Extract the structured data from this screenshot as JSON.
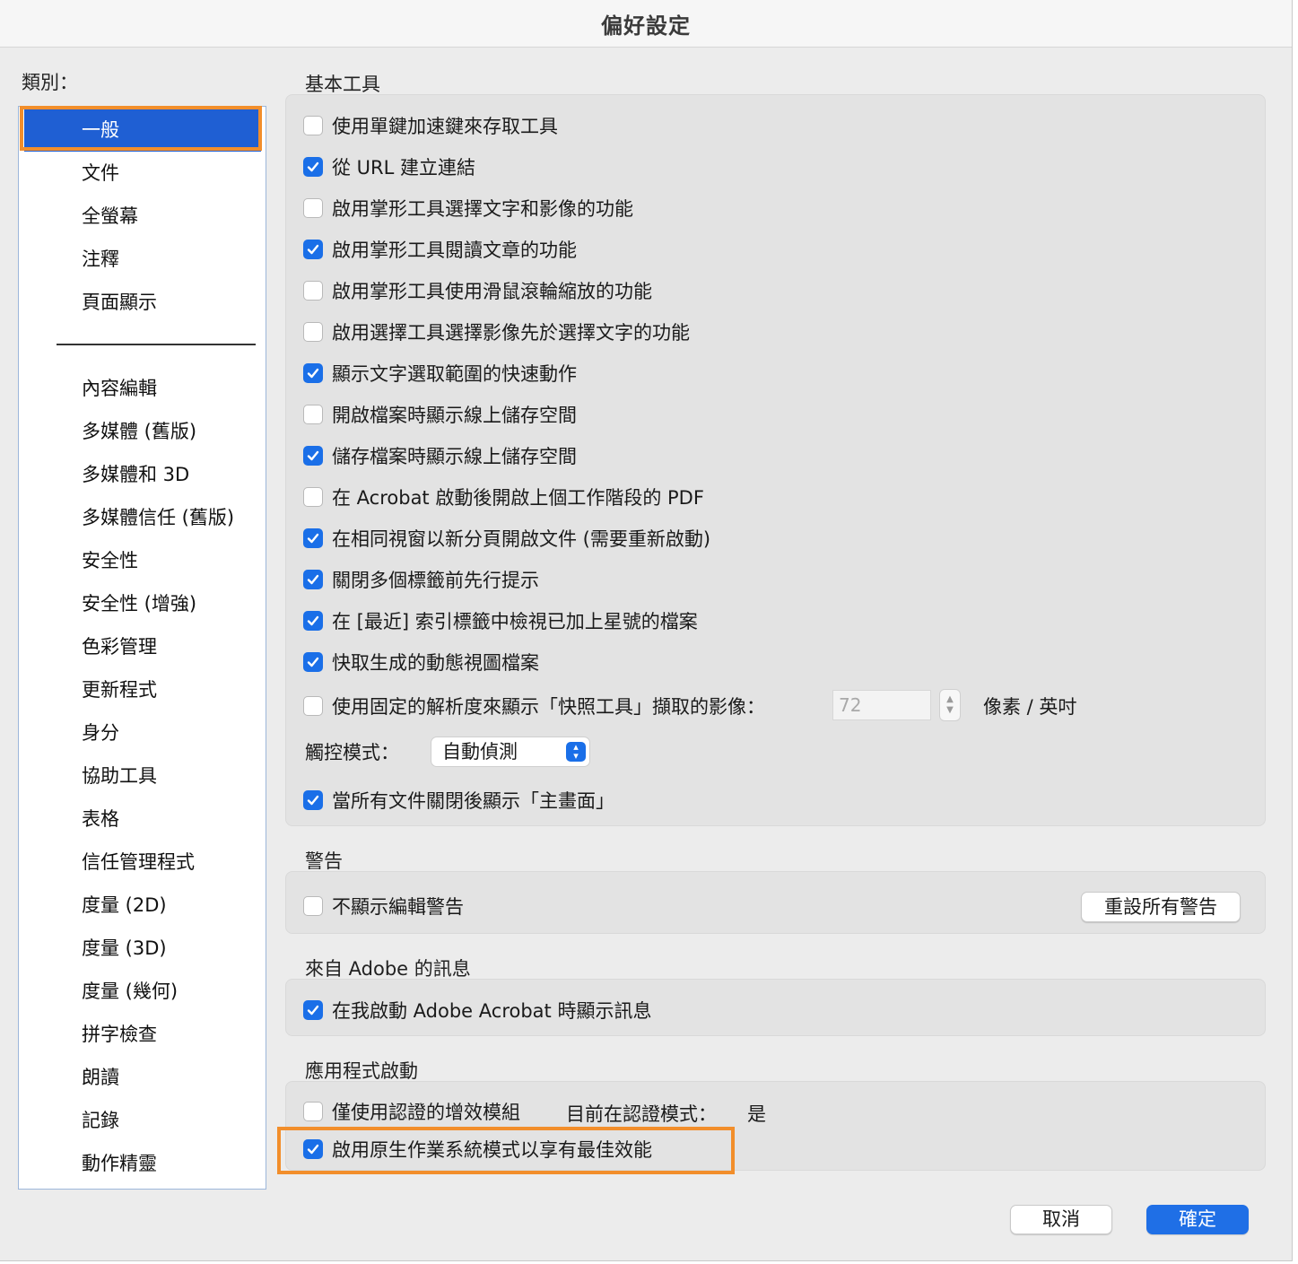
{
  "window": {
    "title": "偏好設定"
  },
  "sidebar": {
    "label": "類別：",
    "items": [
      {
        "label": "一般"
      },
      {
        "label": "文件"
      },
      {
        "label": "全螢幕"
      },
      {
        "label": "注釋"
      },
      {
        "label": "頁面顯示"
      },
      {
        "label": "內容編輯"
      },
      {
        "label": "多媒體 (舊版)"
      },
      {
        "label": "多媒體和 3D"
      },
      {
        "label": "多媒體信任 (舊版)"
      },
      {
        "label": "安全性"
      },
      {
        "label": "安全性 (增強)"
      },
      {
        "label": "色彩管理"
      },
      {
        "label": "更新程式"
      },
      {
        "label": "身分"
      },
      {
        "label": "協助工具"
      },
      {
        "label": "表格"
      },
      {
        "label": "信任管理程式"
      },
      {
        "label": "度量 (2D)"
      },
      {
        "label": "度量 (3D)"
      },
      {
        "label": "度量 (幾何)"
      },
      {
        "label": "拼字檢查"
      },
      {
        "label": "朗讀"
      },
      {
        "label": "記錄"
      },
      {
        "label": "動作精靈"
      }
    ],
    "selected": "一般"
  },
  "basic_tools": {
    "title": "基本工具",
    "options": [
      {
        "label": "使用單鍵加速鍵來存取工具",
        "checked": false
      },
      {
        "label": "從 URL 建立連結",
        "checked": true
      },
      {
        "label": "啟用掌形工具選擇文字和影像的功能",
        "checked": false
      },
      {
        "label": "啟用掌形工具閱讀文章的功能",
        "checked": true
      },
      {
        "label": "啟用掌形工具使用滑鼠滾輪縮放的功能",
        "checked": false
      },
      {
        "label": "啟用選擇工具選擇影像先於選擇文字的功能",
        "checked": false
      },
      {
        "label": "顯示文字選取範圍的快速動作",
        "checked": true
      },
      {
        "label": "開啟檔案時顯示線上儲存空間",
        "checked": false
      },
      {
        "label": "儲存檔案時顯示線上儲存空間",
        "checked": true
      },
      {
        "label": "在 Acrobat 啟動後開啟上個工作階段的 PDF",
        "checked": false
      },
      {
        "label": "在相同視窗以新分頁開啟文件 (需要重新啟動)",
        "checked": true
      },
      {
        "label": "關閉多個標籤前先行提示",
        "checked": true
      },
      {
        "label": "在 [最近] 索引標籤中檢視已加上星號的檔案",
        "checked": true
      },
      {
        "label": "快取生成的動態視圖檔案",
        "checked": true
      },
      {
        "label": "使用固定的解析度來顯示「快照工具」擷取的影像：",
        "checked": false
      }
    ],
    "resolution_value": "72",
    "resolution_unit": "像素 / 英吋",
    "touch_mode_label": "觸控模式：",
    "touch_mode_value": "自動偵測",
    "home_option": {
      "label": "當所有文件關閉後顯示「主畫面」",
      "checked": true
    }
  },
  "warnings": {
    "title": "警告",
    "option": {
      "label": "不顯示編輯警告",
      "checked": false
    },
    "reset_button": "重設所有警告"
  },
  "adobe_messages": {
    "title": "來自 Adobe 的訊息",
    "option": {
      "label": "在我啟動 Adobe Acrobat 時顯示訊息",
      "checked": true
    }
  },
  "app_startup": {
    "title": "應用程式啟動",
    "certified_option": {
      "label": "僅使用認證的增效模組",
      "checked": false
    },
    "cert_mode_label": "目前在認證模式：",
    "cert_mode_value": "是",
    "native_option": {
      "label": "啟用原生作業系統模式以享有最佳效能",
      "checked": true
    }
  },
  "footer": {
    "cancel": "取消",
    "ok": "確定"
  },
  "colors": {
    "accent": "#1f6fe6",
    "highlight": "#f28e2b"
  }
}
